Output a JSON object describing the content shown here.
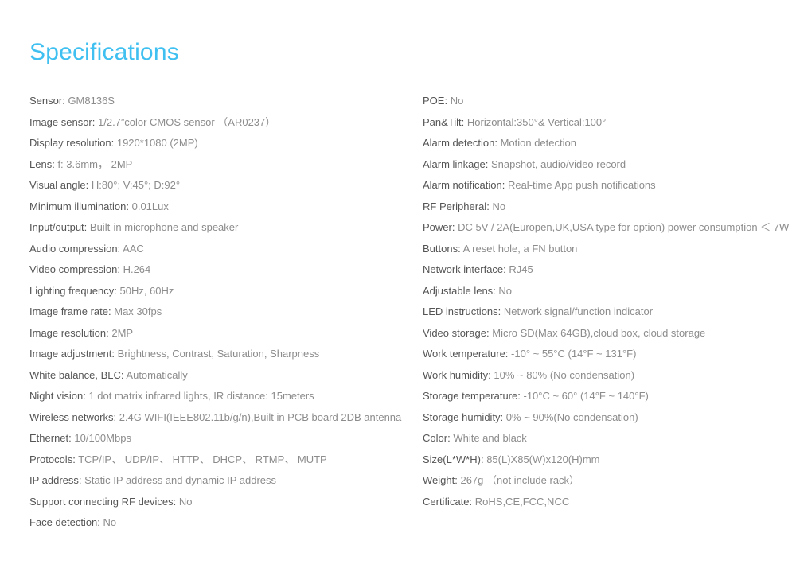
{
  "title": "Specifications",
  "colors": {
    "title": "#3fc0f0",
    "label": "#555555",
    "value": "#8c8c8c",
    "background": "#ffffff"
  },
  "left_column": [
    {
      "label": "Sensor:",
      "value": "GM8136S"
    },
    {
      "label": "Image sensor:",
      "value": " 1/2.7”color CMOS sensor （AR0237）"
    },
    {
      "label": "Display resolution:",
      "value": "1920*1080 (2MP)"
    },
    {
      "label": "Lens:",
      "value": "f: 3.6mm， 2MP"
    },
    {
      "label": "Visual angle:",
      "value": "H:80°; V:45°; D:92°"
    },
    {
      "label": "Minimum illumination:",
      "value": "0.01Lux"
    },
    {
      "label": "Input/output:",
      "value": "Built-in microphone and speaker"
    },
    {
      "label": "Audio compression:",
      "value": "AAC"
    },
    {
      "label": "Video compression:",
      "value": "H.264"
    },
    {
      "label": "Lighting frequency:",
      "value": "50Hz, 60Hz"
    },
    {
      "label": "Image frame rate:",
      "value": "Max 30fps"
    },
    {
      "label": "Image resolution:",
      "value": "2MP"
    },
    {
      "label": "Image adjustment:",
      "value": "Brightness, Contrast, Saturation, Sharpness"
    },
    {
      "label": "White balance, BLC:",
      "value": "Automatically"
    },
    {
      "label": "Night vision:",
      "value": "1 dot matrix infrared lights, IR distance: 15meters"
    },
    {
      "label": "Wireless networks:",
      "value": "2.4G WIFI(IEEE802.11b/g/n),Built in PCB board 2DB antenna"
    },
    {
      "label": "Ethernet:",
      "value": "10/100Mbps"
    },
    {
      "label": "Protocols:",
      "value": "TCP/IP、 UDP/IP、 HTTP、 DHCP、 RTMP、 MUTP"
    },
    {
      "label": "IP address:",
      "value": "Static IP address and dynamic IP address"
    },
    {
      "label": "Support connecting RF devices:",
      "value": "No"
    },
    {
      "label": "Face detection:",
      "value": "No"
    }
  ],
  "right_column": [
    {
      "label": "POE:",
      "value": "No"
    },
    {
      "label": "Pan&Tilt:",
      "value": "Horizontal:350°& Vertical:100°"
    },
    {
      "label": "Alarm detection:",
      "value": "Motion detection"
    },
    {
      "label": "Alarm linkage:",
      "value": "Snapshot, audio/video record"
    },
    {
      "label": "Alarm notification:",
      "value": "Real-time App push notifications"
    },
    {
      "label": "RF Peripheral:",
      "value": "No"
    },
    {
      "label": "Power:",
      "value": "DC 5V / 2A(Europen,UK,USA type for option) power consumption ＜ 7W"
    },
    {
      "label": "Buttons:",
      "value": "A reset hole, a FN button"
    },
    {
      "label": "Network interface:",
      "value": "RJ45"
    },
    {
      "label": "Adjustable lens:",
      "value": "No"
    },
    {
      "label": "LED instructions:",
      "value": "Network signal/function indicator"
    },
    {
      "label": "Video storage:",
      "value": "Micro SD(Max 64GB),cloud box, cloud storage"
    },
    {
      "label": "Work temperature:",
      "value": "-10° ~ 55°C  (14°F ~ 131°F)"
    },
    {
      "label": "Work humidity:",
      "value": "10% ~ 80% (No condensation)"
    },
    {
      "label": "Storage temperature:",
      "value": "-10°C ~ 60° (14°F ~ 140°F)"
    },
    {
      "label": "Storage humidity:",
      "value": "0% ~ 90%(No condensation)"
    },
    {
      "label": "Color:",
      "value": "White and black"
    },
    {
      "label": "Size(L*W*H):",
      "value": "85(L)X85(W)x120(H)mm"
    },
    {
      "label": "Weight:",
      "value": "267g （not include rack）"
    },
    {
      "label": "Certificate:",
      "value": "RoHS,CE,FCC,NCC"
    }
  ]
}
